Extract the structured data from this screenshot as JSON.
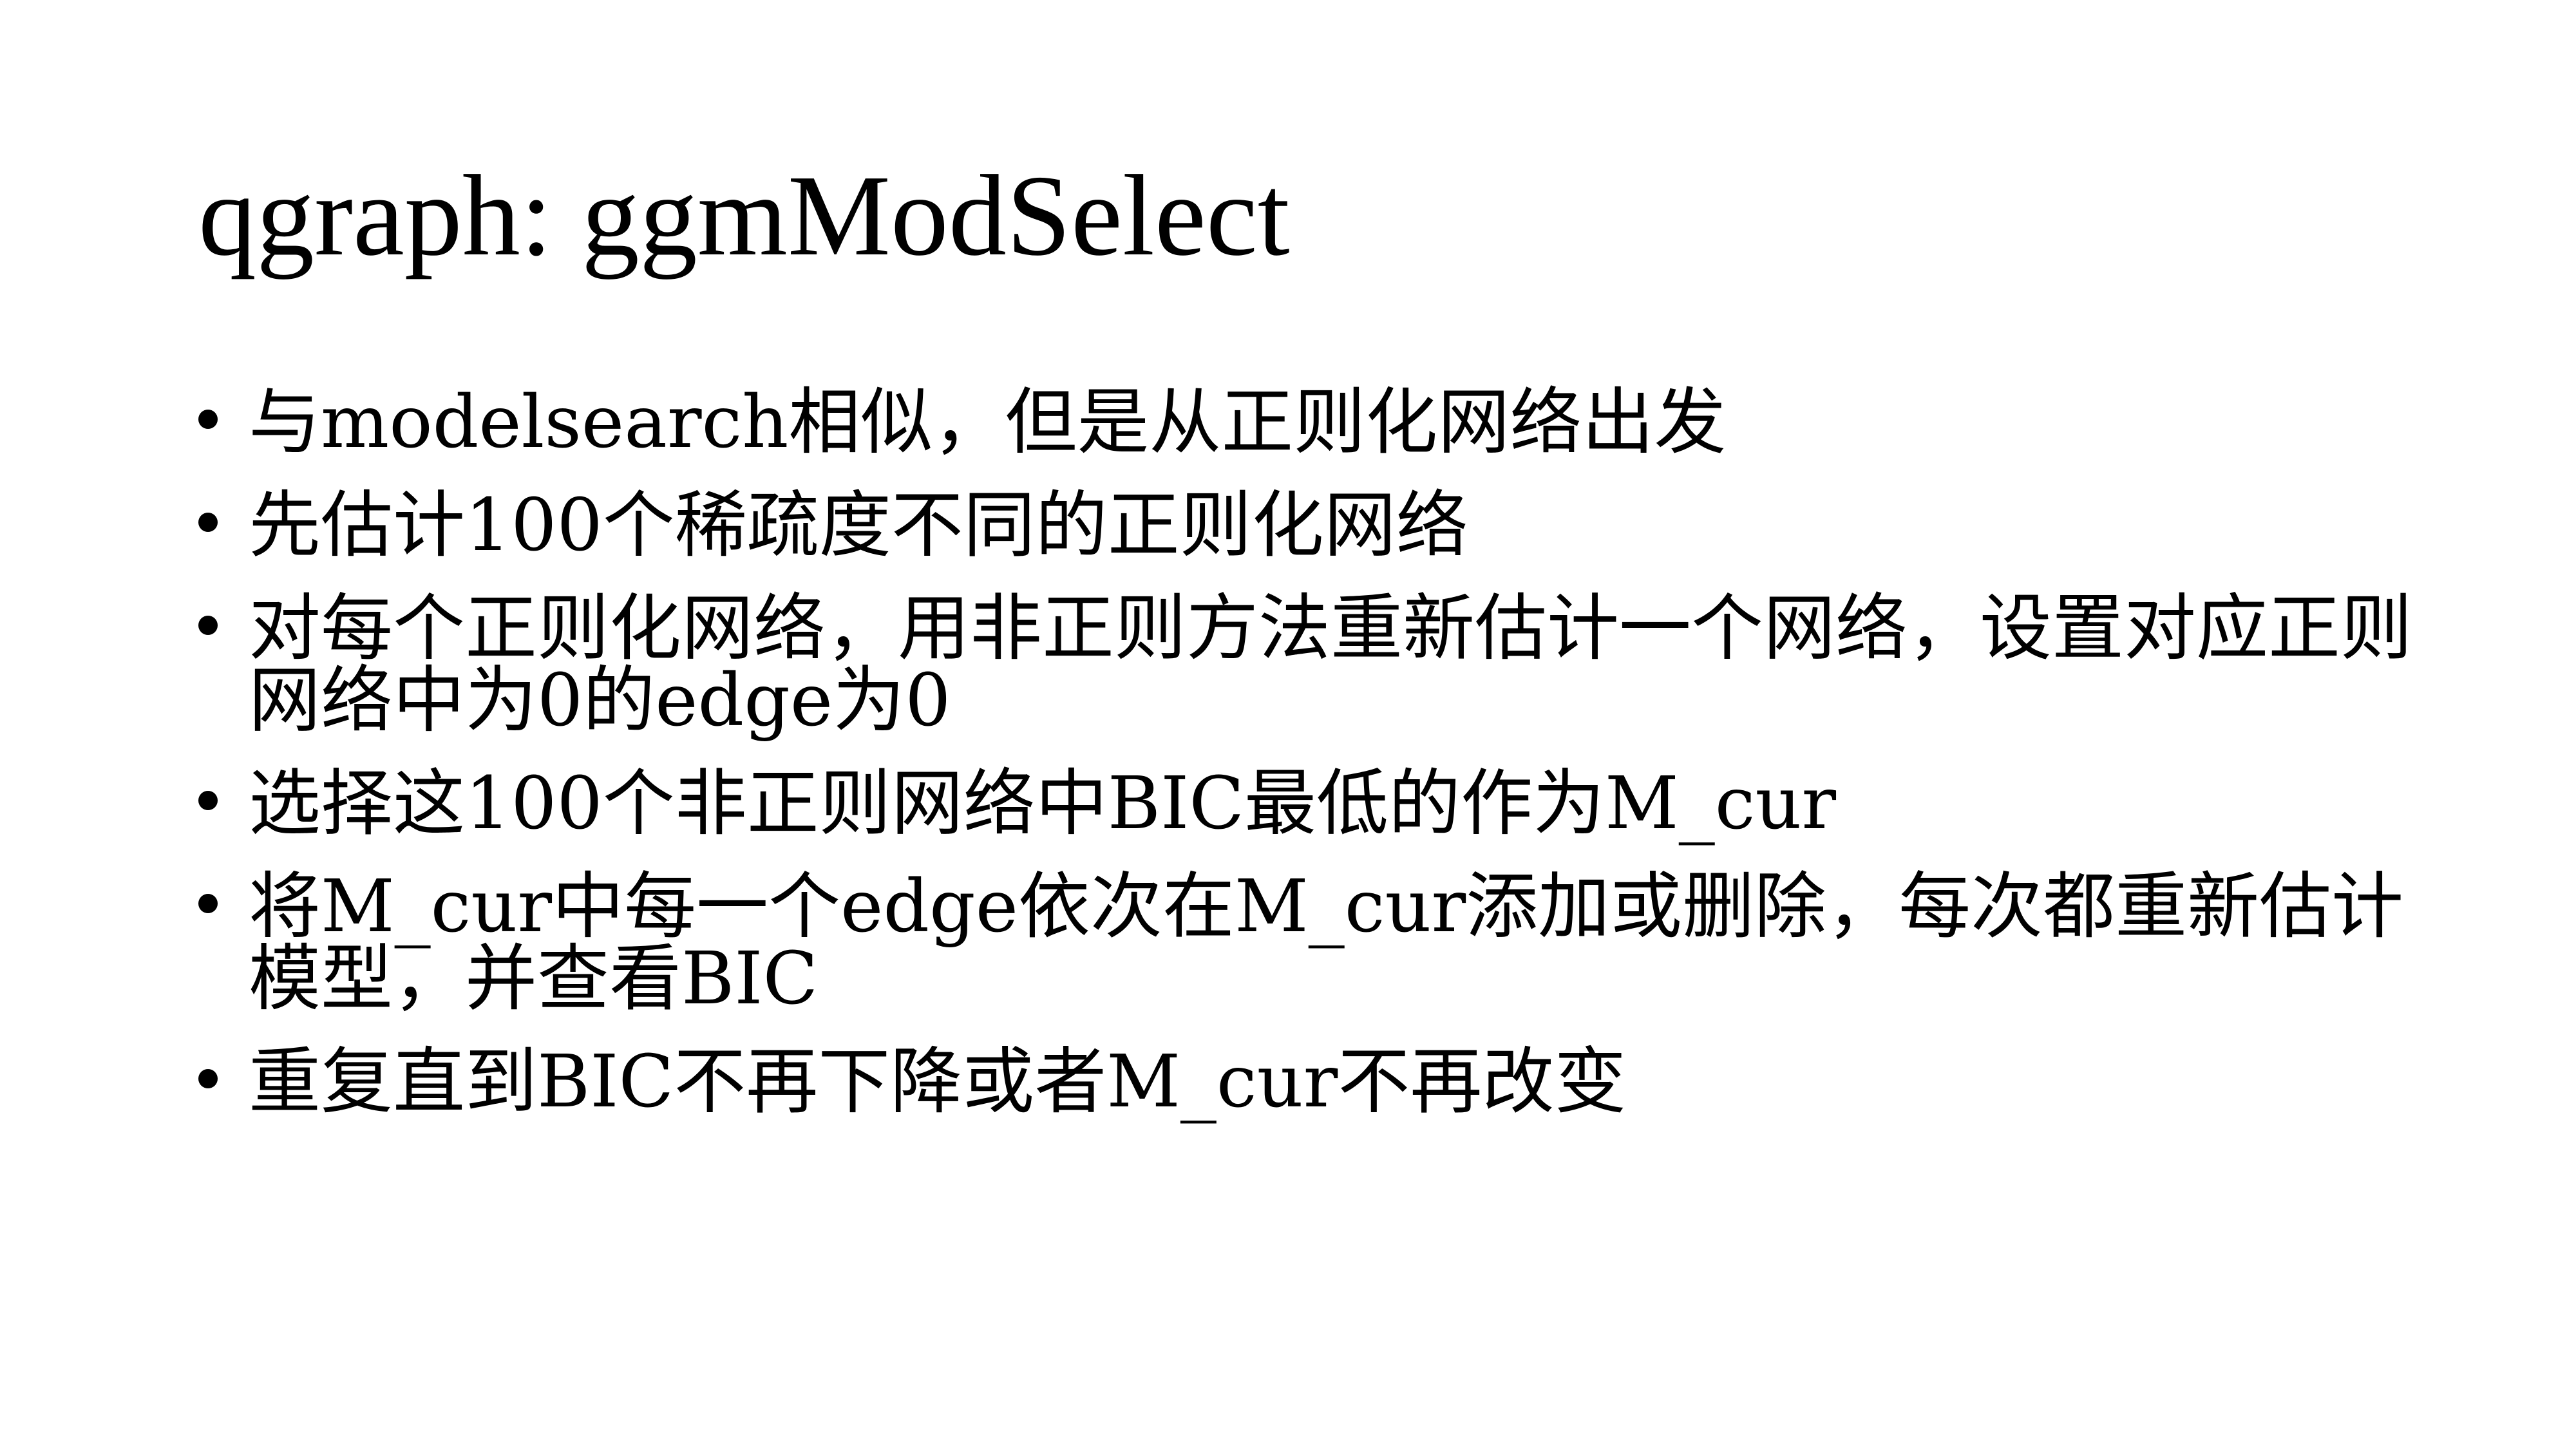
{
  "slide": {
    "title": "qgraph: ggmModSelect",
    "bullets": [
      "与modelsearch相似，但是从正则化网络出发",
      "先估计100个稀疏度不同的正则化网络",
      "对每个正则化网络，用非正则方法重新估计一个网络，设置对应正则网络中为0的edge为0",
      "选择这100个非正则网络中BIC最低的作为M_cur",
      "将M_cur中每一个edge依次在M_cur添加或删除，每次都重新估计模型，并查看BIC",
      "重复直到BIC不再下降或者M_cur不再改变"
    ]
  }
}
